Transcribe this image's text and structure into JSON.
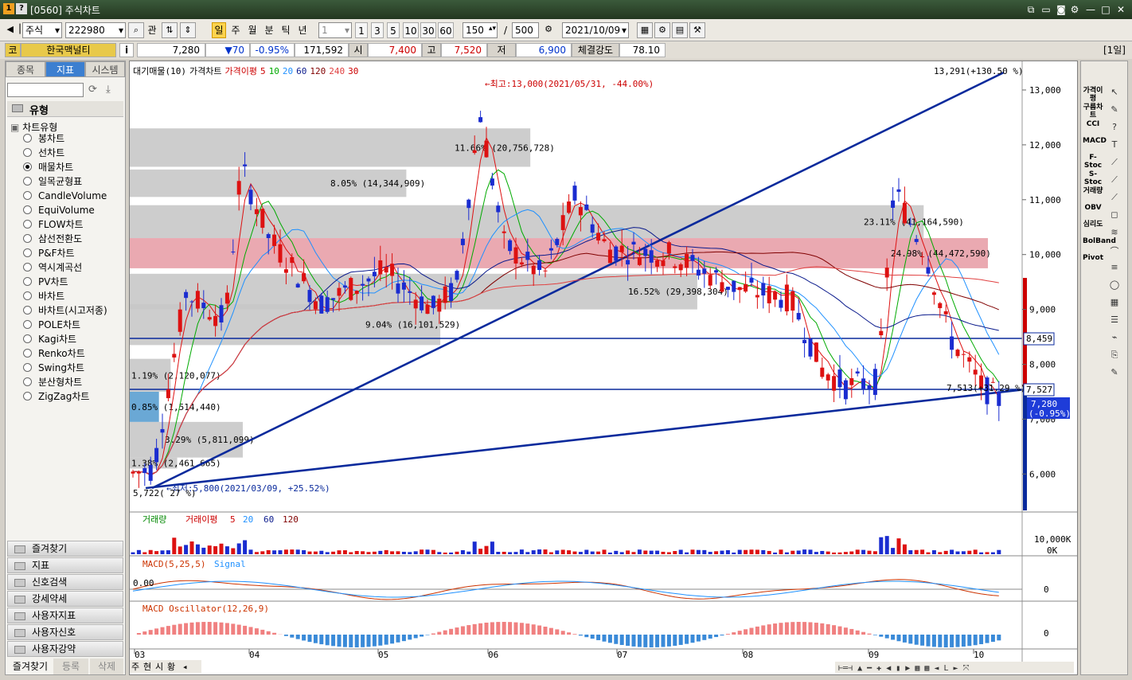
{
  "window": {
    "badge1": "1",
    "badge2": "?",
    "title": "[0560] 주식차트"
  },
  "toolbar": {
    "market": "주식",
    "code": "222980",
    "btn_gwan": "관",
    "periods": [
      "일",
      "주",
      "월",
      "분",
      "틱",
      "년"
    ],
    "interval": "1",
    "quick": [
      "1",
      "3",
      "5",
      "10",
      "30",
      "60"
    ],
    "count": "150",
    "slash": "/",
    "max": "500",
    "date": "2021/10/09"
  },
  "quote": {
    "code_label": "코",
    "name": "한국맥널티",
    "info": "i",
    "price": "7,280",
    "change": "▼70",
    "pct": "-0.95%",
    "volume": "171,592",
    "open_label": "시",
    "open": "7,400",
    "high_label": "고",
    "high": "7,520",
    "low_label": "저",
    "low": "6,900",
    "strength_label": "체결강도",
    "strength": "78.10",
    "period_tag": "[1일]"
  },
  "sidebar": {
    "tabs": [
      "종목",
      "지표",
      "시스템"
    ],
    "group_label": "유형",
    "tree_label": "차트유형",
    "chart_types": [
      "봉차트",
      "선차트",
      "매물차트",
      "일목균형표",
      "CandleVolume",
      "EquiVolume",
      "FLOW차트",
      "삼선전환도",
      "P&F차트",
      "역시계곡선",
      "PV차트",
      "바차트",
      "바차트(시고저종)",
      "POLE차트",
      "Kagi차트",
      "Renko차트",
      "Swing차트",
      "분산형차트",
      "ZigZag차트"
    ],
    "selected_type": "매물차트",
    "bottom_groups": [
      "즐겨찾기",
      "지표",
      "신호검색",
      "강세약세",
      "사용자지표",
      "사용자신호",
      "사용자강약"
    ],
    "footer_tabs": [
      "즐겨찾기",
      "등록",
      "삭제"
    ]
  },
  "chart": {
    "legend": {
      "items": [
        "대기매물(10)",
        "가격차트",
        "가격이평",
        "5",
        "10",
        "20",
        "60",
        "120",
        "240",
        "30"
      ],
      "colors": [
        "#000000",
        "#000000",
        "#cc0000",
        "#cc0000",
        "#00aa00",
        "#1e90ff",
        "#0a1a8c",
        "#800000",
        "#e04040",
        "#cc0000"
      ]
    },
    "top_right_label": "13,291(+130.50 %)",
    "high_marker": "←최고:13,000(2021/05/31, -44.00%)",
    "low_marker": "←최저:5,800(2021/03/09, +25.52%)",
    "low_level_label": "5,722( 27 %)",
    "low_level_label2": "5,722( 27 %)",
    "trendline_label": "7,513(+31.29 %)",
    "price_axis": [
      "13,000",
      "12,000",
      "11,000",
      "10,000",
      "9,000",
      "8,000",
      "7,000",
      "6,000"
    ],
    "hline_labels": [
      "8,459",
      "7,527"
    ],
    "current_price_tag": "7,280",
    "current_pct_tag": "(-0.95%)",
    "x_labels": [
      "03",
      "04",
      "05",
      "06",
      "07",
      "08",
      "09",
      "10"
    ],
    "volume_profile": [
      {
        "label": "1.38% (2,461,665)",
        "pct": 1.38
      },
      {
        "label": "3.29% (5,811,099)",
        "pct": 3.29
      },
      {
        "label": "0.85% (1,514,440)",
        "pct": 0.85
      },
      {
        "label": "1.19% (2,120,077)",
        "pct": 1.19
      },
      {
        "label": "9.04% (16,101,529)",
        "pct": 9.04
      },
      {
        "label": "16.52% (29,398,304)",
        "pct": 16.52
      },
      {
        "label": "24.98% (44,472,590)",
        "pct": 24.98
      },
      {
        "label": "23.11% (41,164,590)",
        "pct": 23.11
      },
      {
        "label": "8.05% (14,344,909)",
        "pct": 8.05
      },
      {
        "label": "11.66% (20,756,728)",
        "pct": 11.66
      }
    ]
  },
  "volume_panel": {
    "legend": [
      "거래량",
      "거래이평",
      "5",
      "20",
      "60",
      "120"
    ],
    "axis": [
      "10,000K",
      "0K"
    ]
  },
  "macd_panel": {
    "legend": [
      "MACD(5,25,5)",
      "Signal"
    ],
    "axis": "0",
    "level": "0.00"
  },
  "osc_panel": {
    "legend": "MACD Oscillator(12,26,9)",
    "axis": "0"
  },
  "bottom_bar": {
    "buttons": [
      "주",
      "현",
      "시",
      "황"
    ]
  },
  "right_tools": [
    "가격이평",
    "구름차트",
    "CCI",
    "MACD",
    "F-Stoc",
    "S-Stoc",
    "거래량",
    "OBV",
    "심리도",
    "BolBand",
    "Pivot"
  ]
}
